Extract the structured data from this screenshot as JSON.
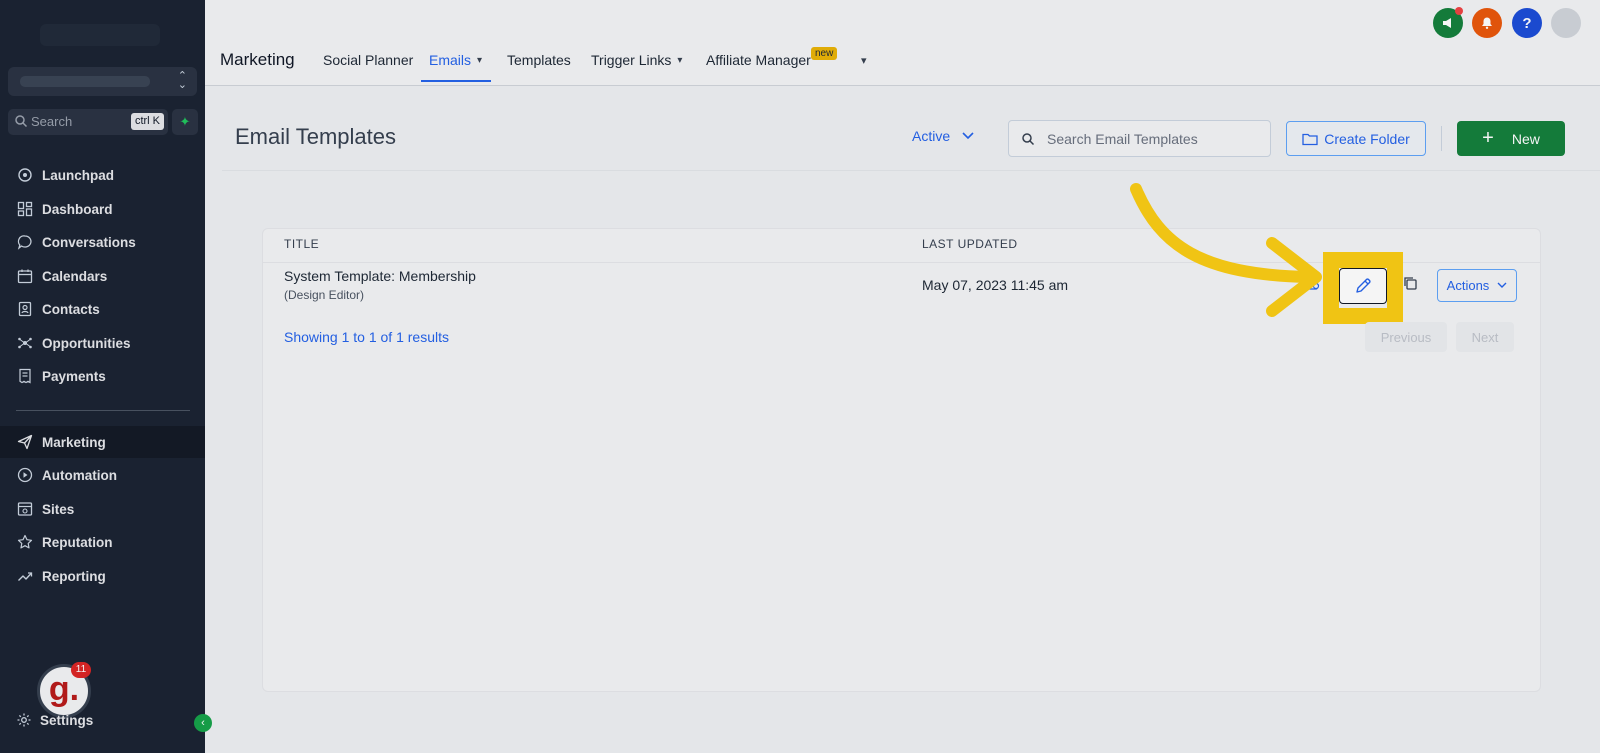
{
  "sidebar": {
    "search": {
      "placeholder": "Search",
      "shortcut": "ctrl K"
    },
    "items": [
      {
        "label": "Launchpad",
        "icon": "launchpad-icon"
      },
      {
        "label": "Dashboard",
        "icon": "dashboard-icon"
      },
      {
        "label": "Conversations",
        "icon": "conversations-icon"
      },
      {
        "label": "Calendars",
        "icon": "calendar-icon"
      },
      {
        "label": "Contacts",
        "icon": "contacts-icon"
      },
      {
        "label": "Opportunities",
        "icon": "opportunities-icon"
      },
      {
        "label": "Payments",
        "icon": "payments-icon"
      },
      {
        "label": "Marketing",
        "icon": "marketing-icon",
        "active": true
      },
      {
        "label": "Automation",
        "icon": "automation-icon"
      },
      {
        "label": "Sites",
        "icon": "sites-icon"
      },
      {
        "label": "Reputation",
        "icon": "star-icon"
      },
      {
        "label": "Reporting",
        "icon": "reporting-icon"
      }
    ],
    "avatar_letter": "g.",
    "avatar_badge": "11",
    "settings_label": "Settings"
  },
  "topbar": {
    "title": "Marketing",
    "tabs": [
      {
        "label": "Social Planner"
      },
      {
        "label": "Emails",
        "active": true,
        "dropdown": true
      },
      {
        "label": "Templates"
      },
      {
        "label": "Trigger Links",
        "dropdown": true
      },
      {
        "label": "Affiliate Manager"
      }
    ],
    "new_badge": "new",
    "help_label": "?"
  },
  "main": {
    "title": "Email Templates",
    "status_filter": "Active",
    "search_placeholder": "Search Email Templates",
    "create_folder_label": "Create Folder",
    "new_label": "New",
    "table": {
      "columns": [
        "TITLE",
        "LAST UPDATED"
      ],
      "rows": [
        {
          "title": "System Template: Membership",
          "subtitle": "(Design Editor)",
          "last_updated": "May 07, 2023 11:45 am",
          "actions_label": "Actions"
        }
      ]
    },
    "results_text": "Showing 1 to 1 of 1 results",
    "pagination": {
      "previous": "Previous",
      "next": "Next"
    }
  },
  "colors": {
    "sidebar_bg": "#1c2433",
    "accent_blue": "#2563eb",
    "new_button_green": "#15803d",
    "highlight_yellow": "#facc15"
  }
}
